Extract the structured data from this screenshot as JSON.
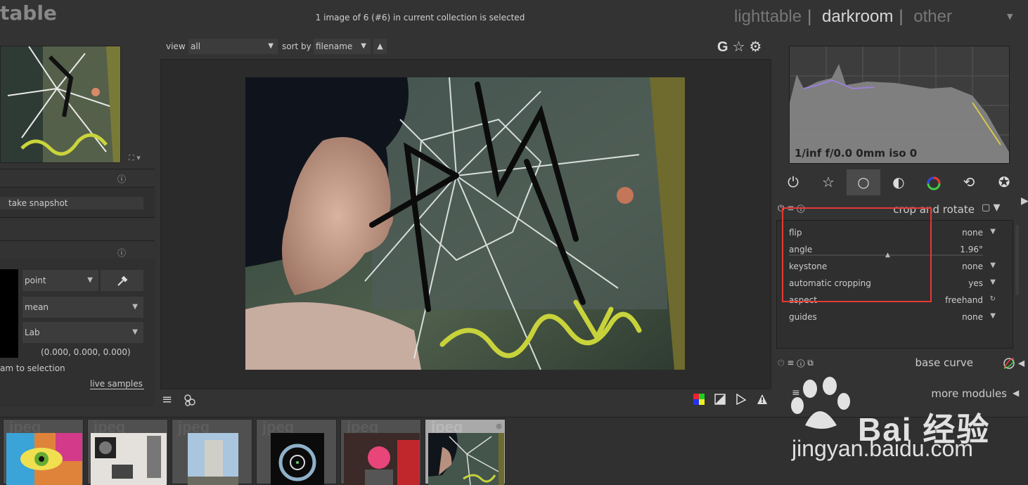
{
  "header": {
    "app_title": "table",
    "collection_info": "1 image of 6 (#6) in current collection is selected",
    "views": [
      "lighttable",
      "darkroom",
      "other"
    ],
    "active_view": "darkroom",
    "separator": "|"
  },
  "left": {
    "snapshot_button": "take snapshot",
    "picker": {
      "mode": "point",
      "statistic": "mean",
      "colorspace": "Lab",
      "values": "(0.000, 0.000, 0.000)",
      "restrict_label": "am to selection",
      "live_samples": "live samples"
    }
  },
  "toolbar": {
    "view_label": "view",
    "view_value": "all",
    "sort_label": "sort by",
    "sort_value": "filename",
    "sort_order_icon": "up-triangle-icon",
    "icons": [
      "G",
      "star-icon",
      "gear-icon"
    ]
  },
  "histogram": {
    "exif": "1/inf f/0.0 0mm iso 0"
  },
  "module_groups": [
    "power-icon",
    "star-outline-icon",
    "circle-icon",
    "shaded-circle-icon",
    "color-circle-icon",
    "rotate-circle-icon",
    "aperture-icon"
  ],
  "crop_module": {
    "title": "crop and rotate",
    "params": [
      {
        "label": "flip",
        "value": "none"
      },
      {
        "label": "angle",
        "value": "1.96°"
      },
      {
        "label": "keystone",
        "value": "none"
      },
      {
        "label": "automatic cropping",
        "value": "yes"
      },
      {
        "label": "aspect",
        "value": "freehand"
      },
      {
        "label": "guides",
        "value": "none"
      }
    ]
  },
  "base_curve": {
    "title": "base curve"
  },
  "more_modules": {
    "title": "more modules"
  },
  "filmstrip": {
    "label": "jpeg",
    "selected_index": 5,
    "count": 6
  },
  "watermark": {
    "line1": "Bai 经验",
    "line2": "jingyan.baidu.com"
  },
  "colors": {
    "background": "#333333",
    "panel": "#2f2f2f",
    "highlight_box": "#e53935",
    "text": "#cccccc"
  }
}
